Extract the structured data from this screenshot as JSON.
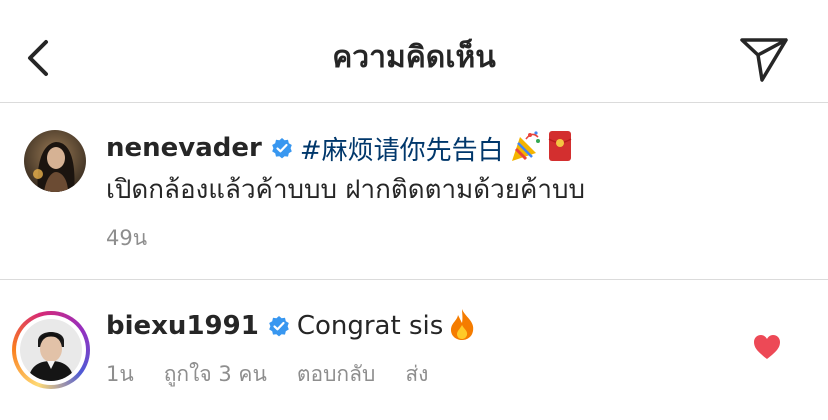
{
  "header": {
    "title": "ความคิดเห็น",
    "back_icon": "chevron-left-icon",
    "share_icon": "paper-plane-icon"
  },
  "caption": {
    "username": "nenevader",
    "verified": true,
    "hashtag": "#麻烦请你先告白",
    "emojis": [
      "party-popper",
      "red-envelope"
    ],
    "text": "เปิดกล้องแล้วค้าบบบ ฝากติดตามด้วยค้าบบ",
    "time": "49น"
  },
  "comment": {
    "username": "biexu1991",
    "verified": true,
    "text": "Congrat sis",
    "emoji": "fire",
    "time": "1น",
    "likes": "ถูกใจ 3 คน",
    "reply": "ตอบกลับ",
    "send": "ส่ง",
    "liked": true
  },
  "colors": {
    "verified_blue": "#3897f0",
    "hashtag_blue": "#00376b",
    "like_red": "#ed4956",
    "meta_gray": "#8e8e8e"
  }
}
